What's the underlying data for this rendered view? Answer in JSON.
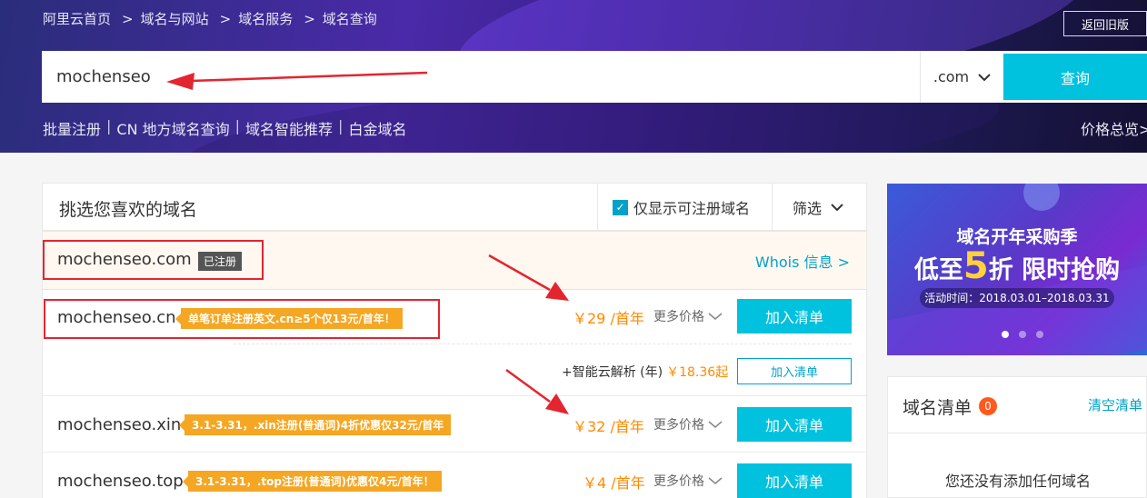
{
  "breadcrumb": [
    "阿里云首页",
    "域名与网站",
    "域名服务",
    "域名查询"
  ],
  "breadcrumb_sep": ">",
  "header": {
    "old_version_label": "返回旧版",
    "price_overview": "价格总览>"
  },
  "search": {
    "value": "mochenseo",
    "tld": ".com",
    "query_label": "查询"
  },
  "quick_links": [
    "批量注册",
    "CN 地方域名查询",
    "域名智能推荐",
    "白金域名"
  ],
  "quick_links_sep": "|",
  "panel": {
    "title": "挑选您喜欢的域名",
    "only_available_label": "仅显示可注册域名",
    "only_available_checked": true,
    "filter_label": "筛选"
  },
  "results": [
    {
      "domain": "mochenseo.com",
      "status": "已注册",
      "whois_label": "Whois 信息 >"
    },
    {
      "domain": "mochenseo.cn",
      "promo": "单笔订单注册英文.cn≥5个仅13元/首年！",
      "price": "￥29 /首年",
      "more_price": "更多价格",
      "add_label": "加入清单",
      "addon": {
        "text": "+智能云解析 (年)",
        "price": "￥18.36起",
        "add_label": "加入清单"
      }
    },
    {
      "domain": "mochenseo.xin",
      "promo": "3.1-3.31，.xin注册(普通词)4折优惠仅32元/首年",
      "price": "￥32 /首年",
      "more_price": "更多价格",
      "add_label": "加入清单"
    },
    {
      "domain": "mochenseo.top",
      "promo": "3.1-3.31，.top注册(普通词)优惠仅4元/首年！",
      "price": "￥4 /首年",
      "more_price": "更多价格",
      "add_label": "加入清单"
    }
  ],
  "banner": {
    "title": "域名开年采购季",
    "main_prefix": "低至",
    "main_big": "5",
    "main_suffix": "折 限时抢购",
    "date": "活动时间：2018.03.01–2018.03.31",
    "active_dot": 0
  },
  "cart": {
    "title": "域名清单",
    "count": "0",
    "clear_label": "清空清单",
    "empty_text": "您还没有添加任何域名"
  },
  "colors": {
    "accent": "#00c1de",
    "price": "#ff8a00",
    "promo": "#f5a623",
    "annotation": "#e3252f"
  }
}
